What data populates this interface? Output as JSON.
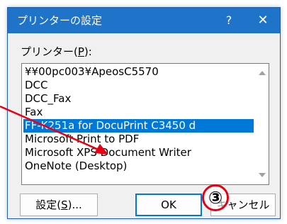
{
  "dialog": {
    "title": "プリンターの設定",
    "help": "?",
    "close": "✕"
  },
  "printer_label": {
    "text_before": "プリンター(",
    "accelerator": "P",
    "text_after": "):"
  },
  "printers": [
    "¥¥00pc003¥ApeosC5570",
    "DCC",
    "DCC_Fax",
    "Fax",
    "FF-K251a for DocuPrint C3450 d",
    "Microsoft Print to PDF",
    "Microsoft XPS Document Writer",
    "OneNote (Desktop)"
  ],
  "selected_printer_index": 4,
  "buttons": {
    "settings_before": "設定(",
    "settings_accelerator": "S",
    "settings_after": ")...",
    "ok": "OK",
    "cancel": "キャンセル"
  },
  "annotation": {
    "step_marker": "③",
    "arrow_color": "#e60012"
  },
  "colors": {
    "titlebar": "#1f73c9",
    "selection": "#0078d7"
  }
}
